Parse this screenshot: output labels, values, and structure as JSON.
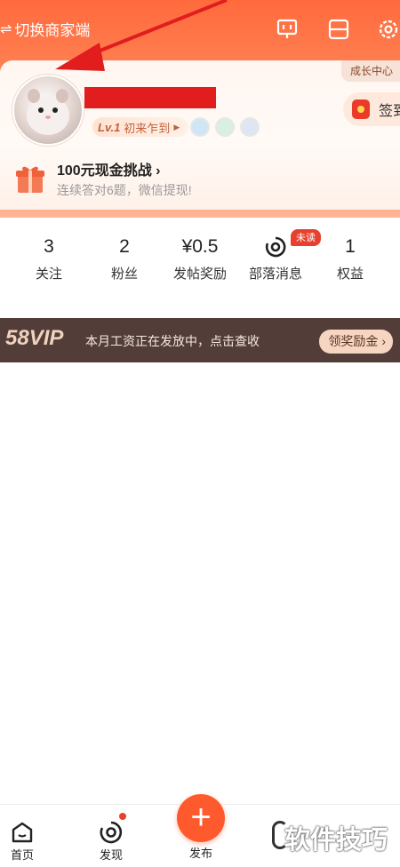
{
  "topbar": {
    "switch_label": "切换商家端",
    "icons": [
      "customer-service-icon",
      "scan-icon",
      "settings-icon"
    ]
  },
  "profile": {
    "growth_center": "成长中心",
    "level_label": "Lv.1",
    "level_title": "初来乍到",
    "sign_label": "签到"
  },
  "challenge": {
    "title": "100元现金挑战",
    "subtitle": "连续答对6题，微信提现!"
  },
  "stats": [
    {
      "value": "3",
      "label": "关注"
    },
    {
      "value": "2",
      "label": "粉丝"
    },
    {
      "value": "¥0.5",
      "label": "发帖奖励"
    },
    {
      "value": "",
      "label": "部落消息"
    },
    {
      "value": "1",
      "label": "权益"
    }
  ],
  "unread_badge": "未读",
  "vip": {
    "logo": "58VIP",
    "text": "本月工资正在发放中，点击查收",
    "button": "领奖励金"
  },
  "bottom_nav": [
    {
      "label": "首页"
    },
    {
      "label": "发现"
    },
    {
      "label": "发布"
    }
  ],
  "watermark": "软件技巧",
  "colors": {
    "accent": "#ff6a3d",
    "vip_bg": "#533d38",
    "badge_red": "#e8402e",
    "redaction": "#e21d1d"
  }
}
